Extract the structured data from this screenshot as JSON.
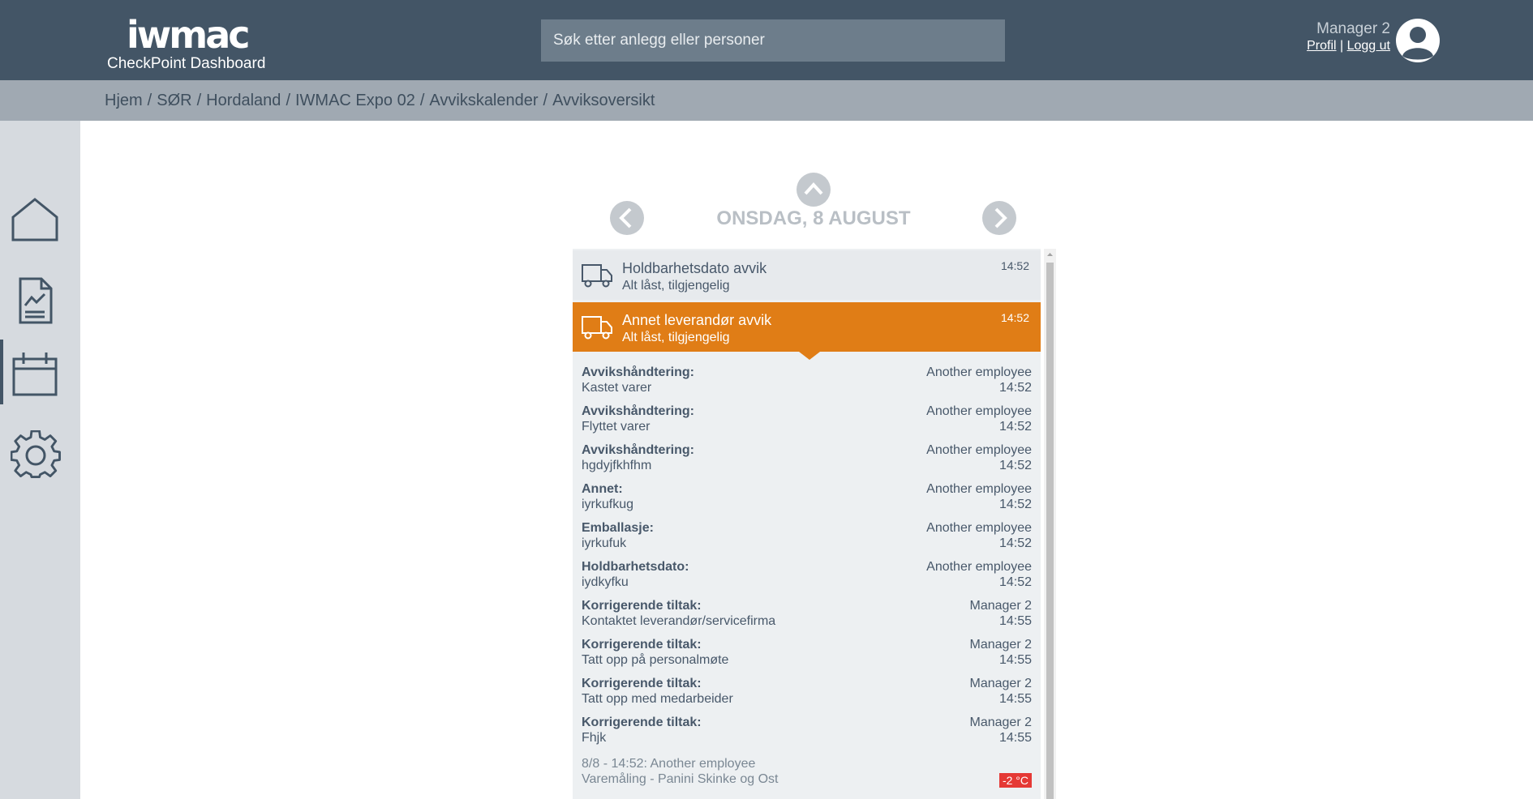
{
  "header": {
    "logo_text": "iwmac",
    "app_name": "CheckPoint Dashboard",
    "search_placeholder": "Søk etter anlegg eller personer",
    "user_name": "Manager 2",
    "profile_link": "Profil",
    "link_separator": "|",
    "logout_link": "Logg ut",
    "bg_color": "#435566"
  },
  "breadcrumb": {
    "items": [
      "Hjem",
      "SØR",
      "Hordaland",
      "IWMAC Expo 02",
      "Avvikskalender",
      "Avviksoversikt"
    ],
    "separator": "/"
  },
  "sidebar": {
    "items": [
      {
        "icon": "home-icon",
        "active": false
      },
      {
        "icon": "report-icon",
        "active": false
      },
      {
        "icon": "calendar-icon",
        "active": true
      },
      {
        "icon": "gear-icon",
        "active": false
      }
    ]
  },
  "calendar": {
    "date_label": "ONSDAG, 8 AUGUST"
  },
  "events": [
    {
      "title": "Holdbarhetsdato avvik",
      "subtitle": "Alt låst, tilgjengelig",
      "time": "14:52",
      "icon": "truck-icon",
      "selected": false
    },
    {
      "title": "Annet leverandør avvik",
      "subtitle": "Alt låst, tilgjengelig",
      "time": "14:52",
      "icon": "truck-icon",
      "selected": true,
      "accent_color": "#e07d16"
    }
  ],
  "details": [
    {
      "label": "Avvikshåndtering:",
      "value": "Kastet varer",
      "person": "Another employee",
      "time": "14:52"
    },
    {
      "label": "Avvikshåndtering:",
      "value": "Flyttet varer",
      "person": "Another employee",
      "time": "14:52"
    },
    {
      "label": "Avvikshåndtering:",
      "value": "hgdyjfkhfhm",
      "person": "Another employee",
      "time": "14:52"
    },
    {
      "label": "Annet:",
      "value": "iyrkufkug",
      "person": "Another employee",
      "time": "14:52"
    },
    {
      "label": "Emballasje:",
      "value": "iyrkufuk",
      "person": "Another employee",
      "time": "14:52"
    },
    {
      "label": "Holdbarhetsdato:",
      "value": "iydkyfku",
      "person": "Another employee",
      "time": "14:52"
    },
    {
      "label": "Korrigerende tiltak:",
      "value": "Kontaktet leverandør/servicefirma",
      "person": "Manager 2",
      "time": "14:55"
    },
    {
      "label": "Korrigerende tiltak:",
      "value": "Tatt opp på personalmøte",
      "person": "Manager 2",
      "time": "14:55"
    },
    {
      "label": "Korrigerende tiltak:",
      "value": "Tatt opp med medarbeider",
      "person": "Manager 2",
      "time": "14:55"
    },
    {
      "label": "Korrigerende tiltak:",
      "value": "Fhjk",
      "person": "Manager 2",
      "time": "14:55"
    }
  ],
  "measurement": {
    "line1": "8/8 - 14:52: Another employee",
    "line2": "Varemåling - Panini Skinke og Ost",
    "temperature": "-2 °C",
    "badge_color": "#e53935"
  }
}
